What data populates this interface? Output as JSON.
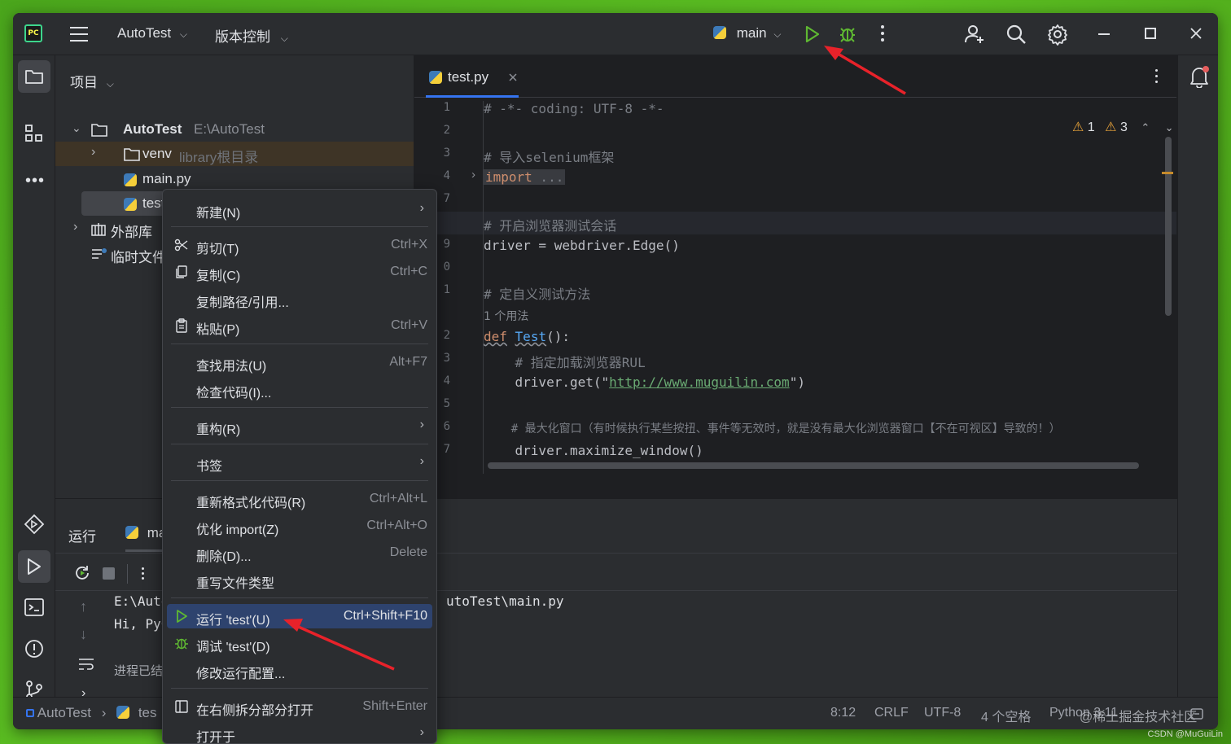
{
  "titlebar": {
    "project_name": "AutoTest",
    "vcs_label": "版本控制",
    "branch": "main"
  },
  "project_panel": {
    "header": "项目",
    "tree": {
      "root_name": "AutoTest",
      "root_path": "E:\\AutoTest",
      "venv_name": "venv",
      "venv_hint": "library根目录",
      "file_main": "main.py",
      "file_test": "test.p",
      "external_libs": "外部库",
      "scratches": "临时文件"
    }
  },
  "editor": {
    "tab_label": "test.py",
    "inspections": {
      "errors": "1",
      "warnings": "3"
    },
    "line_numbers": [
      "1",
      "2",
      "3",
      "4",
      "7",
      "8",
      "9",
      "0",
      "1",
      "",
      "2",
      "3",
      "4",
      "5",
      "6",
      "7"
    ],
    "lines": {
      "l1": "# -*- coding: UTF-8 -*-",
      "l3": "# 导入selenium框架",
      "l4_kw": "import",
      "l4_rest": " ...",
      "l8": "# 开启浏览器测试会话",
      "l9": "driver = webdriver.Edge()",
      "l11": "# 定自义测试方法",
      "usage_hint": "1 个用法",
      "l12_kw": "def",
      "l12_fn": "Test",
      "l12_rest": "():",
      "l13": "    # 指定加载浏览器RUL",
      "l14_pre": "    driver.get(\"",
      "l14_url": "http://www.muguilin.com",
      "l14_post": "\")",
      "l16": "    # 最大化窗口（有时候执行某些按扭、事件等无效时，就是没有最大化浏览器窗口【不在可视区】导致的！）",
      "l17": "    driver.maximize_window()"
    }
  },
  "run_panel": {
    "tab_run": "运行",
    "tab_file": "ma",
    "console_line1_left": "E:\\Auto",
    "console_line1_right": "utoTest\\main.py",
    "console_line2": "Hi, PyC",
    "console_line3": "进程已结束"
  },
  "context_menu": {
    "new": "新建(N)",
    "cut": "剪切(T)",
    "cut_sc": "Ctrl+X",
    "copy": "复制(C)",
    "copy_sc": "Ctrl+C",
    "copy_path": "复制路径/引用...",
    "paste": "粘贴(P)",
    "paste_sc": "Ctrl+V",
    "find_usages": "查找用法(U)",
    "find_usages_sc": "Alt+F7",
    "inspect": "检查代码(I)...",
    "refactor": "重构(R)",
    "bookmarks": "书签",
    "reformat": "重新格式化代码(R)",
    "reformat_sc": "Ctrl+Alt+L",
    "optimize": "优化 import(Z)",
    "optimize_sc": "Ctrl+Alt+O",
    "delete": "删除(D)...",
    "delete_sc": "Delete",
    "override_type": "重写文件类型",
    "run": "运行 'test'(U)",
    "run_sc": "Ctrl+Shift+F10",
    "debug": "调试 'test'(D)",
    "modify_run": "修改运行配置...",
    "split_open": "在右侧拆分部分打开",
    "split_open_sc": "Shift+Enter",
    "open_in": "打开于"
  },
  "statusbar": {
    "crumb_project": "AutoTest",
    "crumb_file": "tes",
    "position": "8:12",
    "line_sep": "CRLF",
    "encoding": "UTF-8",
    "indent": "4 个空格",
    "interpreter": "Python 3.11",
    "watermark_overlay": "@稀土掘金技术社区",
    "csdn_mark": "CSDN @MuGuiLin"
  },
  "colors": {
    "accent_run": "#5fb832",
    "arrow": "#e8222a",
    "selection": "#2e436e",
    "background_panel": "#2b2d30",
    "editor_bg": "#1e1f22"
  }
}
